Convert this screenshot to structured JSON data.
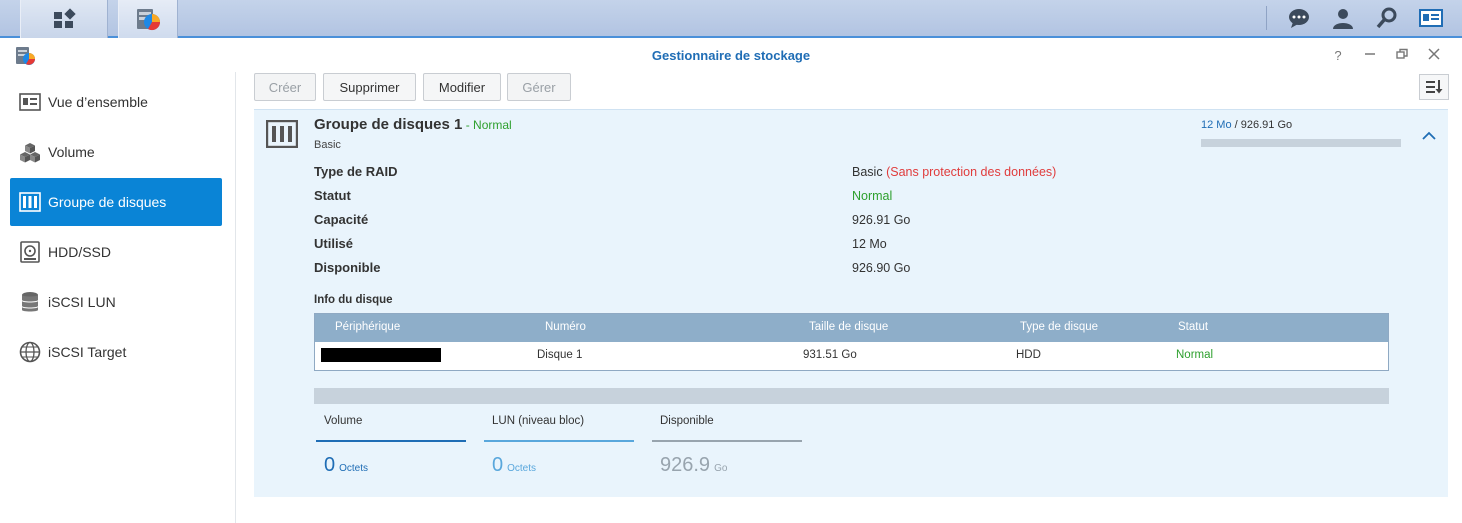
{
  "window": {
    "title": "Gestionnaire de stockage"
  },
  "sidebar": {
    "items": [
      {
        "label": "Vue d’ensemble",
        "icon": "overview-icon"
      },
      {
        "label": "Volume",
        "icon": "cubes-icon"
      },
      {
        "label": "Groupe de disques",
        "icon": "disk-group-icon",
        "active": true
      },
      {
        "label": "HDD/SSD",
        "icon": "hdd-icon"
      },
      {
        "label": "iSCSI LUN",
        "icon": "database-icon"
      },
      {
        "label": "iSCSI Target",
        "icon": "globe-icon"
      }
    ]
  },
  "toolbar": {
    "create": "Créer",
    "delete": "Supprimer",
    "modify": "Modifier",
    "manage": "Gérer"
  },
  "pool": {
    "title": "Groupe de disques 1",
    "separator": " - ",
    "status": "Normal",
    "subtitle": "Basic",
    "used": "12 Mo",
    "slash": " / ",
    "total": "926.91 Go",
    "usage_fraction": 0.0001
  },
  "props": {
    "raid_label": "Type de RAID",
    "raid_value": "Basic",
    "raid_note": "(Sans protection des données)",
    "status_label": "Statut",
    "status_value": "Normal",
    "capacity_label": "Capacité",
    "capacity_value": "926.91 Go",
    "used_label": "Utilisé",
    "used_value": "12 Mo",
    "available_label": "Disponible",
    "available_value": "926.90 Go"
  },
  "disk_info": {
    "caption": "Info du disque",
    "headers": [
      "Périphérique",
      "Numéro",
      "Taille de disque",
      "Type de disque",
      "Statut"
    ],
    "rows": [
      {
        "device": "",
        "number": "Disque 1",
        "size": "931.51 Go",
        "type": "HDD",
        "status": "Normal"
      }
    ]
  },
  "stats": [
    {
      "label": "Volume",
      "value": "0",
      "unit": "Octets",
      "color": "#1f6db5"
    },
    {
      "label": "LUN (niveau bloc)",
      "value": "0",
      "unit": "Octets",
      "color": "#59a7dc"
    },
    {
      "label": "Disponible",
      "value": "926.9",
      "unit": "Go",
      "color": "#98a4ae"
    }
  ],
  "colors": {
    "accent": "#0a84d6",
    "ok": "#2ea02e",
    "warn": "#e03c3c",
    "header": "#8eaec9"
  }
}
